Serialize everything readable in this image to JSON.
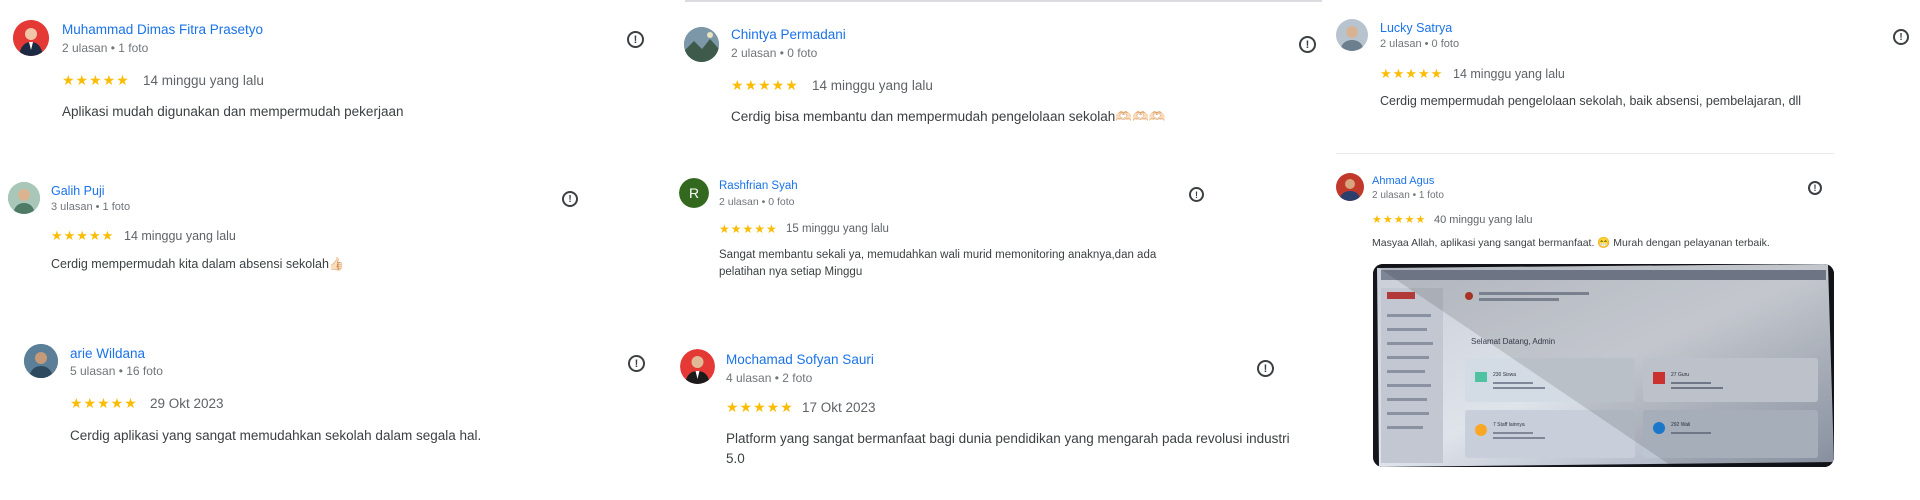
{
  "reviews": [
    {
      "name": "Muhammad Dimas Fitra Prasetyo",
      "meta": "2 ulasan • 1 foto",
      "stars": "★★★★★",
      "date": "14 minggu yang lalu",
      "text": "Aplikasi mudah digunakan dan mempermudah pekerjaan",
      "avatar": "person-suit-icon"
    },
    {
      "name": "Galih Puji",
      "meta": "3 ulasan • 1 foto",
      "stars": "★★★★★",
      "date": "14 minggu yang lalu",
      "text": "Cerdig mempermudah kita dalam absensi sekolah👍🏻",
      "avatar": "person-photo-icon"
    },
    {
      "name": "arie Wildana",
      "meta": "5 ulasan • 16 foto",
      "stars": "★★★★★",
      "date": "29 Okt 2023",
      "text": "Cerdig aplikasi yang sangat memudahkan sekolah dalam segala hal.",
      "avatar": "person-photo-icon"
    },
    {
      "name": "Chintya Permadani",
      "meta": "2 ulasan • 0 foto",
      "stars": "★★★★★",
      "date": "14 minggu yang lalu",
      "text": "Cerdig bisa membantu dan mempermudah pengelolaan sekolah🫶🏻🫶🏻🫶🏻",
      "avatar": "landscape-photo-icon"
    },
    {
      "name": "Rashfrian Syah",
      "meta": "2 ulasan • 0 foto",
      "stars": "★★★★★",
      "date": "15 minggu yang lalu",
      "text": "Sangat membantu sekali ya, memudahkan wali murid memonitoring anaknya,dan ada pelatihan nya setiap Minggu",
      "avatar_letter": "R",
      "avatar_color": "#33691e"
    },
    {
      "name": "Mochamad Sofyan Sauri",
      "meta": "4 ulasan • 2 foto",
      "stars": "★★★★★",
      "date": "17 Okt 2023",
      "text": "Platform yang sangat bermanfaat bagi dunia pendidikan yang mengarah pada revolusi industri 5.0",
      "avatar": "person-suit-icon"
    },
    {
      "name": "Lucky Satrya",
      "meta": "2 ulasan • 0 foto",
      "stars": "★★★★★",
      "date": "14 minggu yang lalu",
      "text": "Cerdig mempermudah pengelolaan sekolah, baik absensi, pembelajaran, dll",
      "avatar": "person-photo-icon"
    },
    {
      "name": "Ahmad Agus",
      "meta": "2 ulasan • 1 foto",
      "stars": "★★★★★",
      "date": "40 minggu yang lalu",
      "text": "Masyaa Allah, aplikasi yang sangat bermanfaat. 😁 Murah dengan pelayanan terbaik.",
      "avatar": "person-photo-icon"
    }
  ],
  "photo": {
    "greeting": "Selamat Datang, Admin",
    "cards": [
      {
        "value": "230 Siswa",
        "color": "#4fc3a1"
      },
      {
        "value": "27 Guru",
        "color": "#e53935"
      },
      {
        "value": "7 Staff lainnya",
        "color": "#f9a825"
      },
      {
        "value": "292 Wali",
        "color": "#1e88e5"
      }
    ]
  },
  "flag_glyph": "!",
  "colors": {
    "link": "#1a73e8",
    "star": "#fbbc04",
    "text": "#3c4043",
    "meta": "#70757a"
  }
}
